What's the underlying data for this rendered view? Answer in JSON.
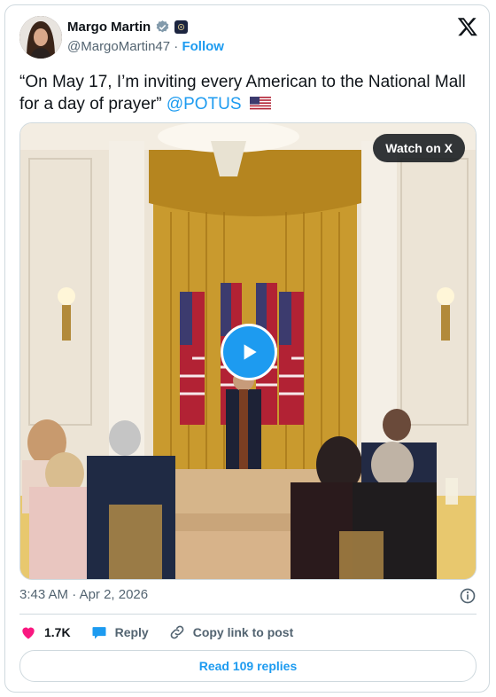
{
  "author": {
    "display_name": "Margo Martin",
    "handle": "@MargoMartin47",
    "separator": "·",
    "follow_label": "Follow"
  },
  "tweet": {
    "text": "“On May 17, I’m inviting every American to the National Mall for a day of prayer”",
    "mention": "@POTUS",
    "flag_emoji": "us-flag"
  },
  "media": {
    "watch_label": "Watch on X",
    "play_icon": "play-icon"
  },
  "meta": {
    "time": "3:43 AM",
    "separator": "·",
    "date": "Apr 2, 2026"
  },
  "actions": {
    "likes": "1.7K",
    "reply_label": "Reply",
    "copy_label": "Copy link to post"
  },
  "read_replies": "Read 109 replies",
  "colors": {
    "accent": "#1d9bf0",
    "like": "#f91880",
    "muted": "#536471",
    "text": "#0f1419"
  }
}
